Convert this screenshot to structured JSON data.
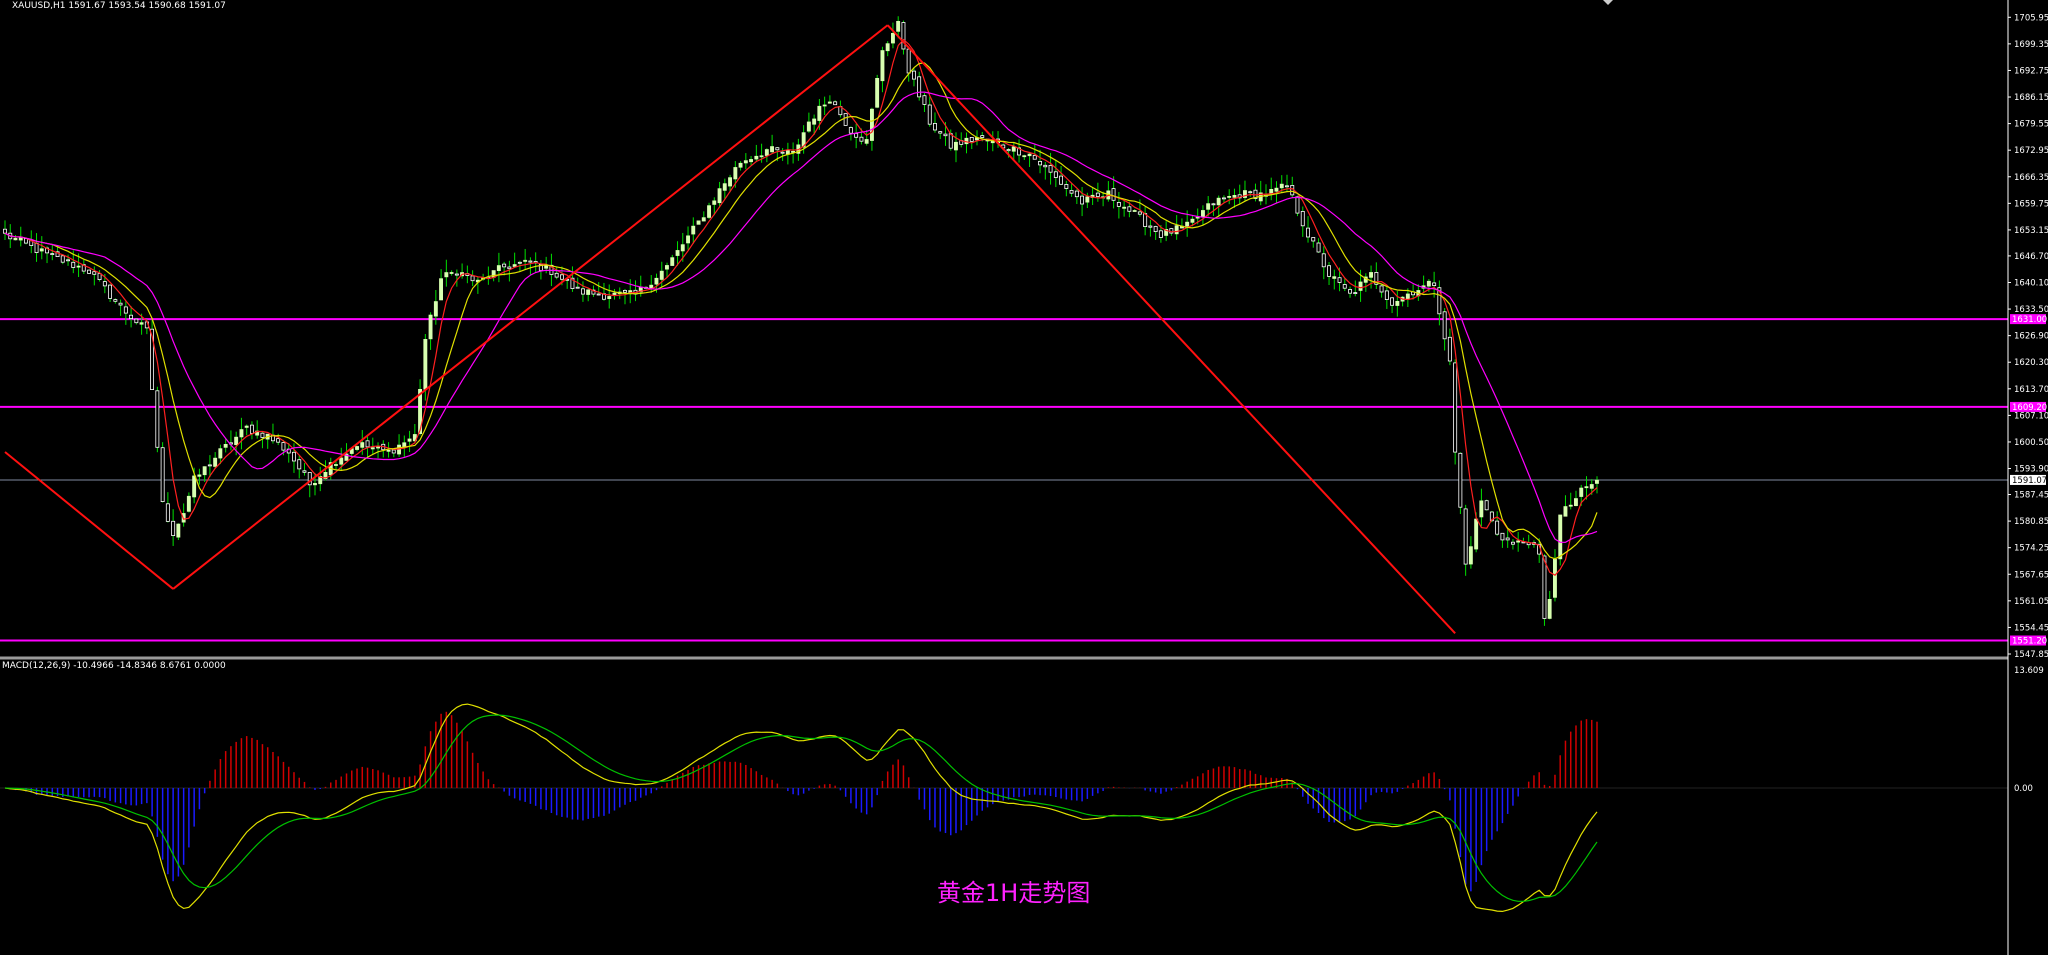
{
  "header": {
    "main_info": "XAUUSD,H1  1591.67 1593.54 1590.68 1591.07",
    "macd_info": "MACD(12,26,9) -10.4966 -14.8346 8.6761 0.0000"
  },
  "caption": "黄金1H走势图",
  "colors": {
    "background": "#000000",
    "bull_candle": "#d8ffb0",
    "bear_candle": "#ffffff",
    "wick": "#00e000",
    "ma_fast": "#ff2020",
    "ma_mid": "#e0e000",
    "ma_slow": "#ff00ff",
    "trendline": "#ff1010",
    "level_line": "#ff00ff",
    "current_price_line": "#7f8aa0",
    "macd_hist_pos": "#d00000",
    "macd_hist_neg": "#1a1aff",
    "macd_line": "#e0e000",
    "signal_line": "#00c000",
    "axis_tag_bg": "#ff00ff",
    "current_tag_bg": "#ffffff"
  },
  "chart_data": [
    {
      "type": "candlestick",
      "symbol": "XAUUSD",
      "timeframe": "H1",
      "ylim": [
        1547.85,
        1709.0
      ],
      "y_ticks": [
        "1705.95",
        "1699.35",
        "1692.75",
        "1686.15",
        "1679.55",
        "1672.95",
        "1666.35",
        "1659.75",
        "1653.15",
        "1646.70",
        "1640.10",
        "1633.50",
        "1626.90",
        "1620.30",
        "1613.70",
        "1607.10",
        "1600.50",
        "1593.90",
        "1587.45",
        "1580.85",
        "1574.25",
        "1567.65",
        "1561.05",
        "1554.45",
        "1547.85"
      ],
      "horizontal_levels": [
        {
          "value": 1631.0,
          "label": "1631.00"
        },
        {
          "value": 1609.2,
          "label": "1609.20"
        },
        {
          "value": 1551.2,
          "label": "1551.20"
        }
      ],
      "current_price": {
        "value": 1591.07,
        "label": "1591.07"
      },
      "trendlines": [
        {
          "from": [
            0,
            1598.0
          ],
          "to": [
            32,
            1564.0
          ]
        },
        {
          "from": [
            32,
            1564.0
          ],
          "to": [
            168,
            1704.0
          ]
        },
        {
          "from": [
            168,
            1704.0
          ],
          "to": [
            276,
            1553.0
          ]
        }
      ],
      "anchor_closes": [
        [
          0,
          1652
        ],
        [
          8,
          1647
        ],
        [
          16,
          1643
        ],
        [
          22,
          1634
        ],
        [
          27,
          1628
        ],
        [
          30,
          1585
        ],
        [
          32,
          1578
        ],
        [
          34,
          1583
        ],
        [
          36,
          1591
        ],
        [
          41,
          1598
        ],
        [
          46,
          1604
        ],
        [
          50,
          1602
        ],
        [
          54,
          1598
        ],
        [
          58,
          1590
        ],
        [
          62,
          1595
        ],
        [
          67,
          1600
        ],
        [
          73,
          1598
        ],
        [
          78,
          1602
        ],
        [
          80,
          1626
        ],
        [
          83,
          1641
        ],
        [
          86,
          1643
        ],
        [
          90,
          1640
        ],
        [
          95,
          1644
        ],
        [
          100,
          1645
        ],
        [
          104,
          1643
        ],
        [
          109,
          1638
        ],
        [
          114,
          1637
        ],
        [
          120,
          1637
        ],
        [
          126,
          1644
        ],
        [
          132,
          1655
        ],
        [
          136,
          1663
        ],
        [
          140,
          1670
        ],
        [
          145,
          1673
        ],
        [
          150,
          1672
        ],
        [
          153,
          1680
        ],
        [
          157,
          1686
        ],
        [
          161,
          1678
        ],
        [
          164,
          1675
        ],
        [
          167,
          1698
        ],
        [
          170,
          1704
        ],
        [
          172,
          1693
        ],
        [
          176,
          1680
        ],
        [
          180,
          1674
        ],
        [
          185,
          1676
        ],
        [
          190,
          1674
        ],
        [
          195,
          1672
        ],
        [
          200,
          1666
        ],
        [
          205,
          1660
        ],
        [
          210,
          1662
        ],
        [
          215,
          1657
        ],
        [
          220,
          1652
        ],
        [
          225,
          1654
        ],
        [
          230,
          1660
        ],
        [
          235,
          1662
        ],
        [
          240,
          1662
        ],
        [
          244,
          1664
        ],
        [
          248,
          1652
        ],
        [
          252,
          1642
        ],
        [
          256,
          1637
        ],
        [
          260,
          1642
        ],
        [
          264,
          1635
        ],
        [
          268,
          1638
        ],
        [
          272,
          1640
        ],
        [
          275,
          1620
        ],
        [
          276,
          1598
        ],
        [
          278,
          1570
        ],
        [
          281,
          1586
        ],
        [
          284,
          1578
        ],
        [
          287,
          1575
        ],
        [
          290,
          1576
        ],
        [
          292,
          1572
        ],
        [
          293,
          1556
        ],
        [
          294,
          1562
        ],
        [
          296,
          1582
        ],
        [
          300,
          1588
        ],
        [
          303,
          1591
        ]
      ]
    },
    {
      "type": "macd",
      "params": "MACD(12,26,9)",
      "values": {
        "macd": -10.4966,
        "signal": -14.8346,
        "histogram": 8.6761,
        "extra": 0.0
      },
      "ylim": [
        -18.5,
        13.609
      ],
      "y_ticks": [
        "13.609",
        "0.00"
      ],
      "zero_line": 0.0
    }
  ]
}
